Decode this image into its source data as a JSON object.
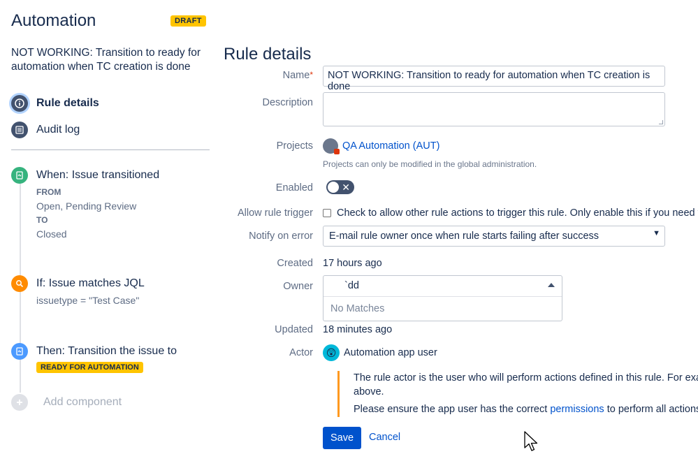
{
  "sidebar": {
    "title": "Automation",
    "badge": "DRAFT",
    "rule_name": "NOT WORKING: Transition to ready for automation when TC creation is done",
    "nav": [
      {
        "label": "Rule details",
        "icon": "info-icon"
      },
      {
        "label": "Audit log",
        "icon": "list-icon"
      }
    ],
    "components": {
      "trigger": {
        "title": "When: Issue transitioned",
        "from_key": "FROM",
        "from_value": "Open, Pending Review",
        "to_key": "TO",
        "to_value": "Closed",
        "color": "#36b37e"
      },
      "condition": {
        "title": "If: Issue matches JQL",
        "detail": "issuetype = \"Test Case\"",
        "color": "#ff8b00"
      },
      "action": {
        "title": "Then: Transition the issue to",
        "status": "READY FOR AUTOMATION",
        "color": "#4c9aff"
      }
    },
    "add_component": "Add component"
  },
  "main": {
    "title": "Rule details",
    "labels": {
      "name": "Name",
      "description": "Description",
      "projects": "Projects",
      "enabled": "Enabled",
      "allow_trigger": "Allow rule trigger",
      "notify": "Notify on error",
      "created": "Created",
      "owner": "Owner",
      "updated": "Updated",
      "actor": "Actor"
    },
    "name_value": "NOT WORKING: Transition to ready for automation when TC creation is done",
    "description_value": "",
    "project_name": "QA Automation (AUT)",
    "projects_help": "Projects can only be modified in the global administration.",
    "enabled": false,
    "allow_trigger_text": "Check to allow other rule actions to trigger this rule. Only enable this if you need this",
    "notify_value": "E-mail rule owner once when rule starts failing after success",
    "created_value": "17 hours ago",
    "owner_query": "`dd",
    "owner_no_matches": "No Matches",
    "updated_value": "18 minutes ago",
    "actor_name": "Automation app user",
    "info_line1": "The rule actor is the user who will perform actions defined in this rule. For example",
    "info_line2": "above.",
    "info_line3_pre": "Please ensure the app user has the correct",
    "info_link": "permissions",
    "info_line3_post": "to perform all actions in th",
    "save_label": "Save",
    "cancel_label": "Cancel"
  }
}
